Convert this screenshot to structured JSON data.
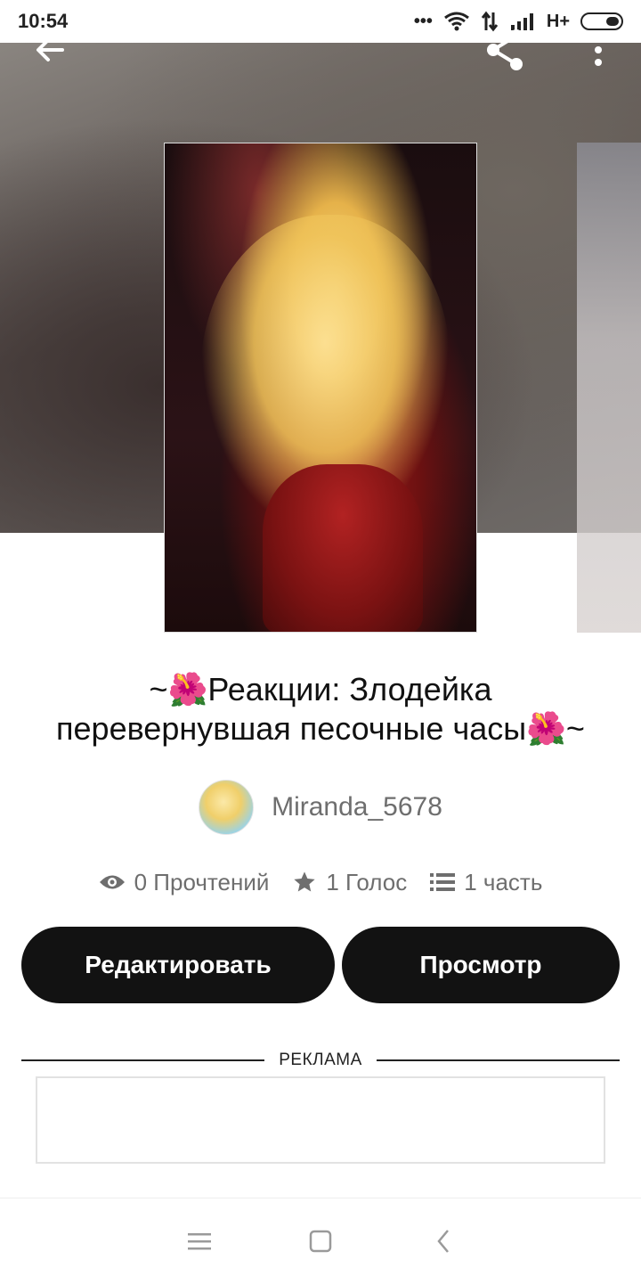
{
  "status_bar": {
    "time": "10:54",
    "dots": "•••",
    "network": "H+"
  },
  "toolbar": {
    "back_icon": "arrow-left-icon",
    "share_icon": "share-icon",
    "more_icon": "more-vertical-icon"
  },
  "story": {
    "title_line1": "~🌺Реакции: Злодейка",
    "title_line2": "перевернувшая песочные часы🌺~",
    "author": "Miranda_5678",
    "stats": {
      "reads": "0 Прочтений",
      "votes": "1 Голос",
      "parts": "1 часть"
    }
  },
  "actions": {
    "edit_label": "Редактировать",
    "view_label": "Просмотр"
  },
  "ad": {
    "label": "РЕКЛАМА"
  },
  "nav": {
    "menu_icon": "menu-icon",
    "home_icon": "square-home-icon",
    "back_icon": "chevron-left-icon"
  },
  "colors": {
    "button_bg": "#121212",
    "muted_text": "#6e6e6e"
  }
}
